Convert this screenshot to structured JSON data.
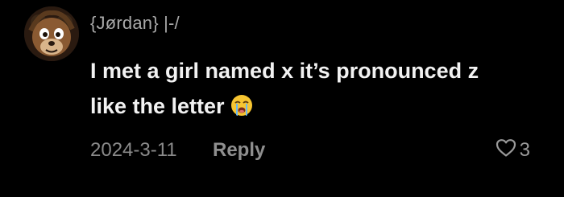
{
  "comment": {
    "username": "{Jørdan} |-/",
    "text_line1": "I met a girl named x it’s pronounced z",
    "text_line2": "like the letter",
    "emoji": "crying-emoji",
    "date": "2024-3-11",
    "reply_label": "Reply",
    "like_count": "3"
  },
  "colors": {
    "background": "#000000",
    "username": "#a9a9a9",
    "text": "#f2f2f2",
    "meta": "#8a8a8a"
  }
}
